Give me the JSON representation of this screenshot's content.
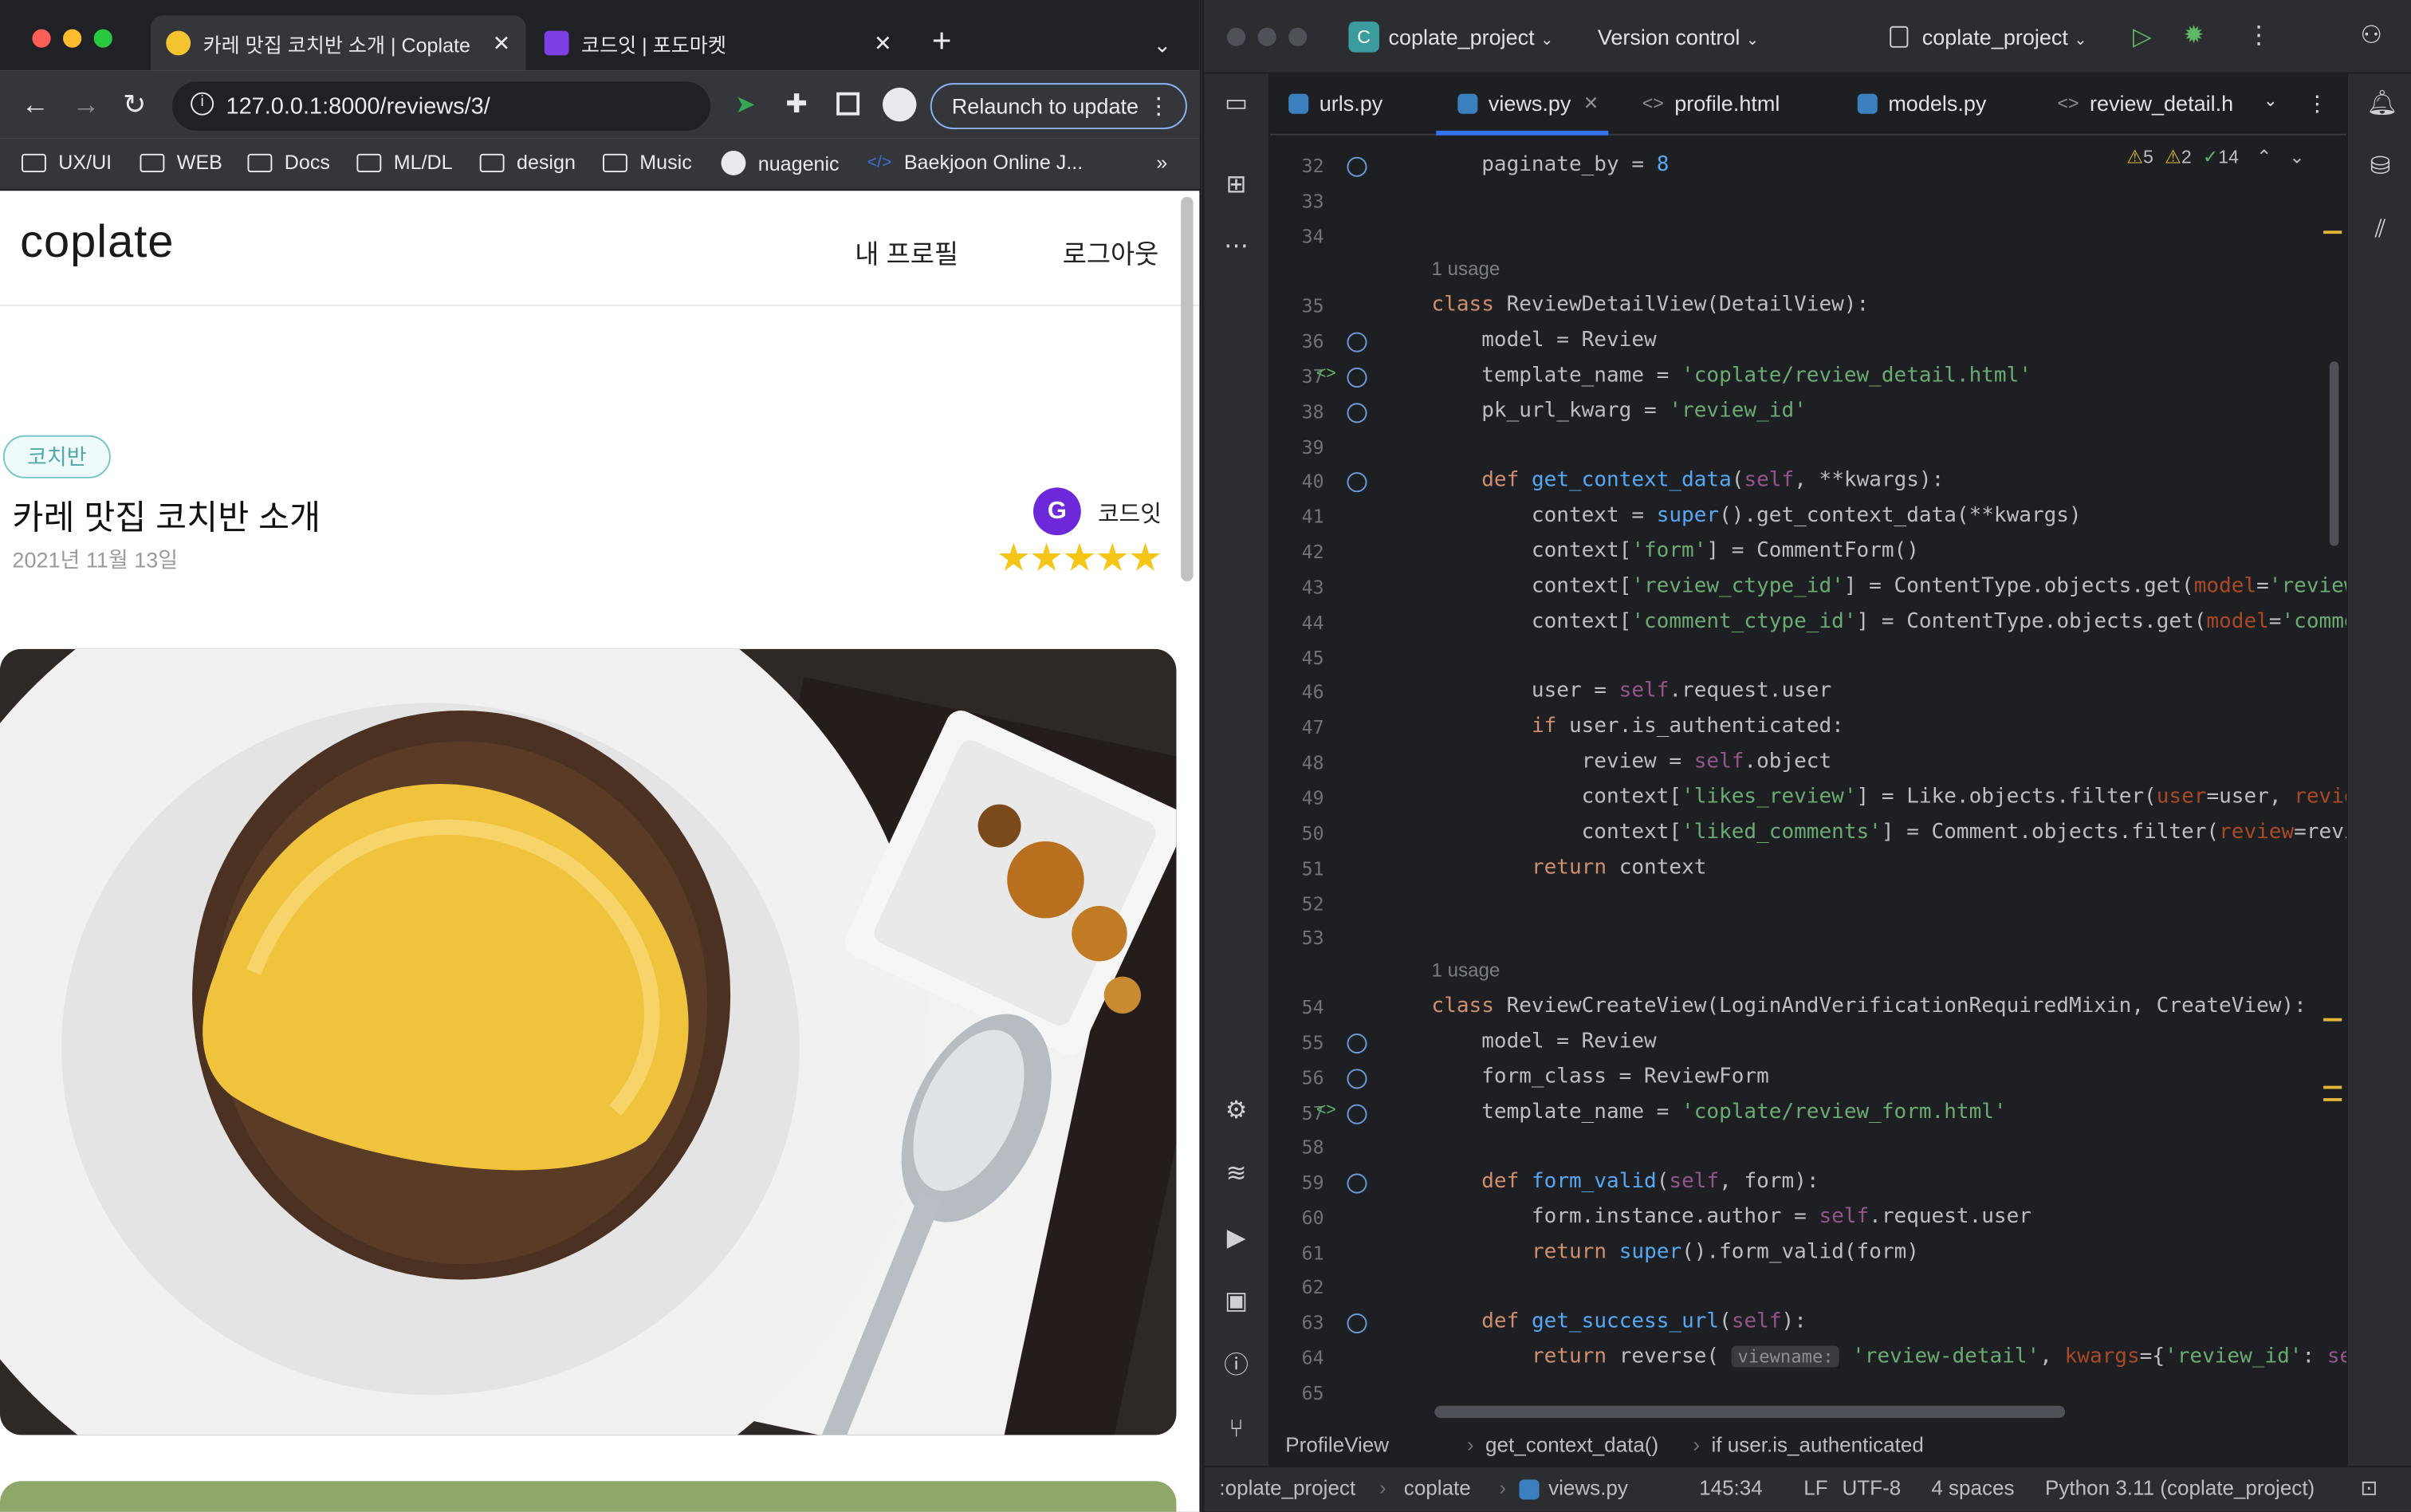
{
  "browser": {
    "tabs": [
      {
        "title": "카레 맛집 코치반 소개 | Coplate",
        "active": true
      },
      {
        "title": "코드잇 | 포도마켓",
        "active": false
      }
    ],
    "url": "127.0.0.1:8000/reviews/3/",
    "relaunch_label": "Relaunch to update",
    "bookmarks": [
      "UX/UI",
      "WEB",
      "Docs",
      "ML/DL",
      "design",
      "Music",
      "nuagenic",
      "Baekjoon Online J..."
    ],
    "bookmarks_more": "»"
  },
  "site": {
    "logo": "coplate",
    "nav": [
      "내 프로필",
      "로그아웃"
    ],
    "review": {
      "tag": "코치반",
      "title": "카레 맛집 코치반 소개",
      "date": "2021년 11월 13일",
      "author": "코드잇",
      "rating": 5,
      "stars": "★★★★★"
    }
  },
  "ide": {
    "project_name": "coplate_project",
    "project_badge": "C",
    "vcs_label": "Version control",
    "run_config": "coplate_project",
    "tabs": [
      {
        "label": "urls.py",
        "active": false
      },
      {
        "label": "views.py",
        "active": true
      },
      {
        "label": "profile.html",
        "active": false
      },
      {
        "label": "models.py",
        "active": false
      },
      {
        "label": "review_detail.h",
        "active": false
      }
    ],
    "inspections": {
      "warnings": "5",
      "weak_warnings": "2",
      "ok": "14"
    },
    "breadcrumb": [
      "ProfileView",
      "get_context_data()",
      "if user.is_authenticated"
    ],
    "status": {
      "path": [
        ":oplate_project",
        "coplate",
        "views.py"
      ],
      "position": "145:34",
      "line_sep": "LF",
      "encoding": "UTF-8",
      "indent": "4 spaces",
      "interpreter": "Python 3.11 (coplate_project)"
    },
    "usage_label": "1 usage",
    "line_numbers": [
      "32",
      "33",
      "34",
      "35",
      "36",
      "37",
      "38",
      "39",
      "40",
      "41",
      "42",
      "43",
      "44",
      "45",
      "46",
      "47",
      "48",
      "49",
      "50",
      "51",
      "52",
      "53",
      "54",
      "55",
      "56",
      "57",
      "58",
      "59",
      "60",
      "61",
      "62",
      "63",
      "64",
      "65"
    ]
  }
}
